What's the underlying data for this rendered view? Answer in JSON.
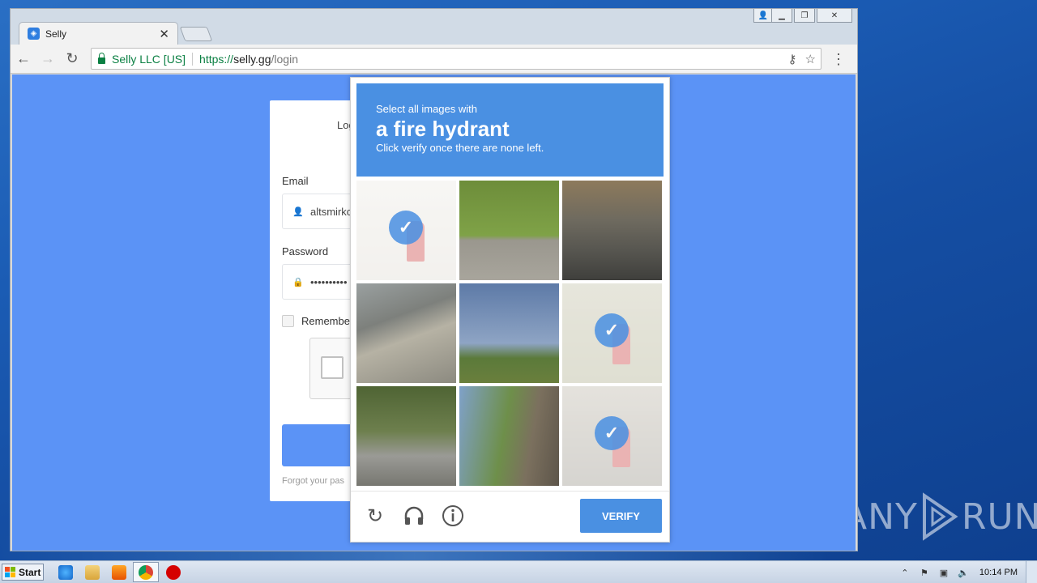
{
  "browser": {
    "tab_title": "Selly",
    "secure_label": "Selly LLC [US]",
    "url_scheme": "https://",
    "url_host": "selly.gg",
    "url_path": "/login"
  },
  "login_card": {
    "title": "Log",
    "email_label": "Email",
    "email_value": "altsmirkc",
    "password_label": "Password",
    "password_value": "••••••••••",
    "remember_label": "Remember",
    "forgot_text": "Forgot your pas"
  },
  "captcha": {
    "instruction_pre": "Select all images with",
    "target_object": "a fire hydrant",
    "instruction_post": "Click verify once there are none left.",
    "verify_label": "VERIFY",
    "tiles": [
      {
        "scene": "hydrant-sidewalk",
        "selected": true
      },
      {
        "scene": "trees-wall-car",
        "selected": false
      },
      {
        "scene": "street-parked-cars",
        "selected": false
      },
      {
        "scene": "highway-barrier",
        "selected": false
      },
      {
        "scene": "field-sky",
        "selected": false
      },
      {
        "scene": "hydrant-grass",
        "selected": true
      },
      {
        "scene": "parking-bus",
        "selected": false
      },
      {
        "scene": "underpass-trees",
        "selected": false
      },
      {
        "scene": "hydrant-sidewalk-2",
        "selected": true
      }
    ],
    "footer_icons": [
      "reload-icon",
      "audio-icon",
      "info-icon"
    ]
  },
  "taskbar": {
    "start_label": "Start",
    "clock": "10:14 PM"
  },
  "watermark": {
    "text_left": "ANY",
    "text_right": "RUN"
  },
  "colors": {
    "page_bg": "#5b93f6",
    "captcha_blue": "#4a90e2",
    "secure_green": "#0b8043"
  }
}
